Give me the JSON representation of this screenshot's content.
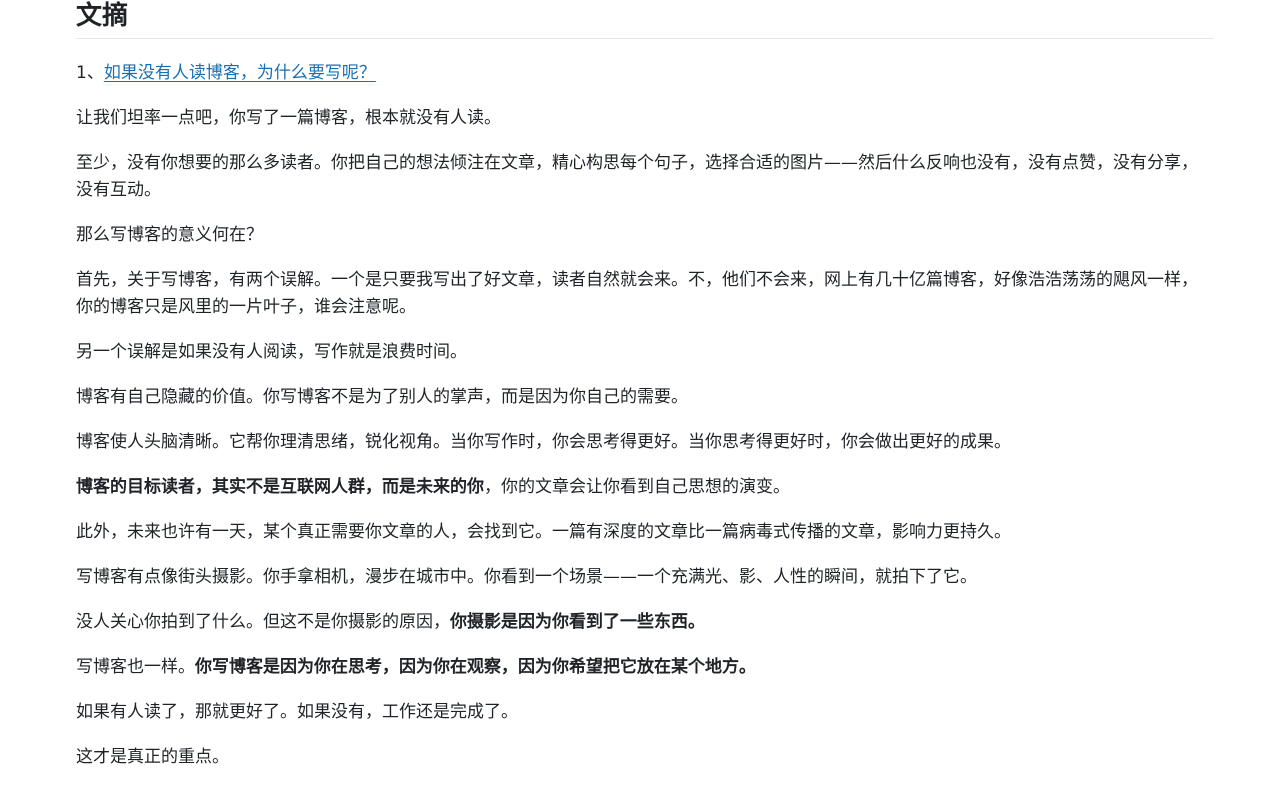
{
  "section": {
    "title": "文摘"
  },
  "article": {
    "number": "1、",
    "title": "如果没有人读博客，为什么要写呢？"
  },
  "paragraphs": [
    {
      "text": "让我们坦率一点吧，你写了一篇博客，根本就没有人读。"
    },
    {
      "text": "至少，没有你想要的那么多读者。你把自己的想法倾注在文章，精心构思每个句子，选择合适的图片——然后什么反响也没有，没有点赞，没有分享，没有互动。"
    },
    {
      "text": "那么写博客的意义何在？"
    },
    {
      "text": "首先，关于写博客，有两个误解。一个是只要我写出了好文章，读者自然就会来。不，他们不会来，网上有几十亿篇博客，好像浩浩荡荡的飓风一样，你的博客只是风里的一片叶子，谁会注意呢。"
    },
    {
      "text": "另一个误解是如果没有人阅读，写作就是浪费时间。"
    },
    {
      "text": "博客有自己隐藏的价值。你写博客不是为了别人的掌声，而是因为你自己的需要。"
    },
    {
      "text": "博客使人头脑清晰。它帮你理清思绪，锐化视角。当你写作时，你会思考得更好。当你思考得更好时，你会做出更好的成果。"
    },
    {
      "bold": "博客的目标读者，其实不是互联网人群，而是未来的你",
      "after": "，你的文章会让你看到自己思想的演变。"
    },
    {
      "text": "此外，未来也许有一天，某个真正需要你文章的人，会找到它。一篇有深度的文章比一篇病毒式传播的文章，影响力更持久。"
    },
    {
      "text": "写博客有点像街头摄影。你手拿相机，漫步在城市中。你看到一个场景——一个充满光、影、人性的瞬间，就拍下了它。"
    },
    {
      "before": "没人关心你拍到了什么。但这不是你摄影的原因，",
      "bold": "你摄影是因为你看到了一些东西。"
    },
    {
      "before": "写博客也一样。",
      "bold": "你写博客是因为你在思考，因为你在观察，因为你希望把它放在某个地方。"
    },
    {
      "text": "如果有人读了，那就更好了。如果没有，工作还是完成了。"
    },
    {
      "text": "这才是真正的重点。"
    }
  ]
}
